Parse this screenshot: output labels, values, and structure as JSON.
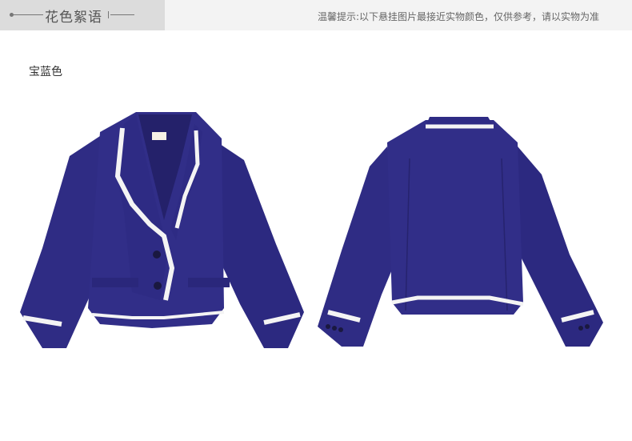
{
  "header": {
    "section_title": "花色絮语",
    "notice": "温馨提示:以下悬挂图片最接近实物颜色，仅供参考，请以实物为准"
  },
  "content": {
    "color_label": "宝蓝色"
  },
  "colors": {
    "jacket_blue": "#2f2c84",
    "jacket_shadow": "#232063",
    "trim_white": "#f4f4f4"
  }
}
